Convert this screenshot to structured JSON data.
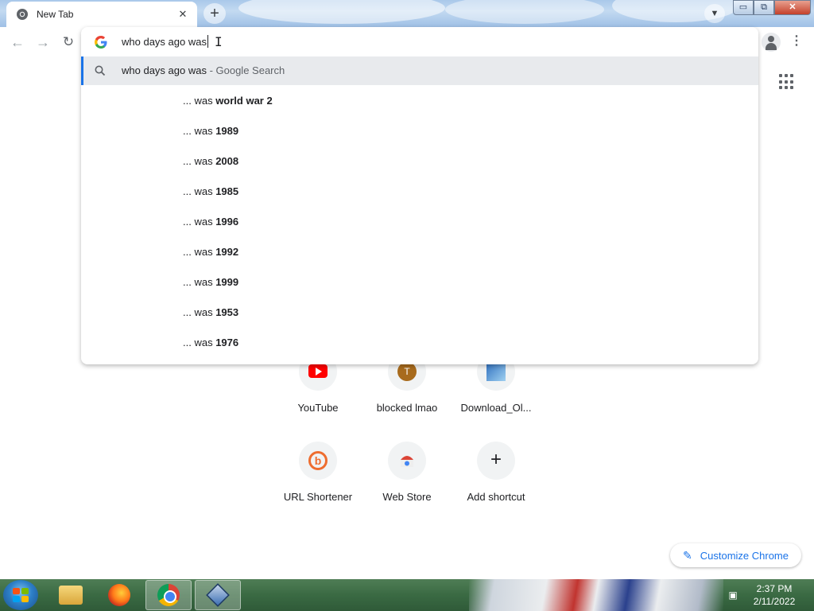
{
  "browser": {
    "tab": {
      "title": "New Tab",
      "close_icon": "close-icon"
    },
    "new_tab_icon": "plus-icon",
    "window_controls": {
      "minimize": "▭",
      "maximize": "⧉",
      "close": "✕"
    }
  },
  "omnibox": {
    "query": "who days ago was",
    "top_suggestion": {
      "text": "who days ago was",
      "suffix": " - Google Search"
    },
    "suggestions": [
      {
        "prefix": "... was ",
        "bold": "world war 2"
      },
      {
        "prefix": "... was ",
        "bold": "1989"
      },
      {
        "prefix": "... was ",
        "bold": "2008"
      },
      {
        "prefix": "... was ",
        "bold": "1985"
      },
      {
        "prefix": "... was ",
        "bold": "1996"
      },
      {
        "prefix": "... was ",
        "bold": "1992"
      },
      {
        "prefix": "... was ",
        "bold": "1999"
      },
      {
        "prefix": "... was ",
        "bold": "1953"
      },
      {
        "prefix": "... was ",
        "bold": "1976"
      }
    ]
  },
  "shortcuts": [
    {
      "label": "YouTube"
    },
    {
      "label": "blocked lmao",
      "letter": "T"
    },
    {
      "label": "Download_Ol..."
    },
    {
      "label": "URL Shortener"
    },
    {
      "label": "Web Store"
    },
    {
      "label": "Add shortcut"
    }
  ],
  "customize_label": "Customize Chrome",
  "taskbar": {
    "time": "2:37 PM",
    "date": "2/11/2022"
  },
  "colors": {
    "accent": "#1a73e8",
    "selected_row": "#e8eaed",
    "taskbar": "#3a6a43"
  }
}
